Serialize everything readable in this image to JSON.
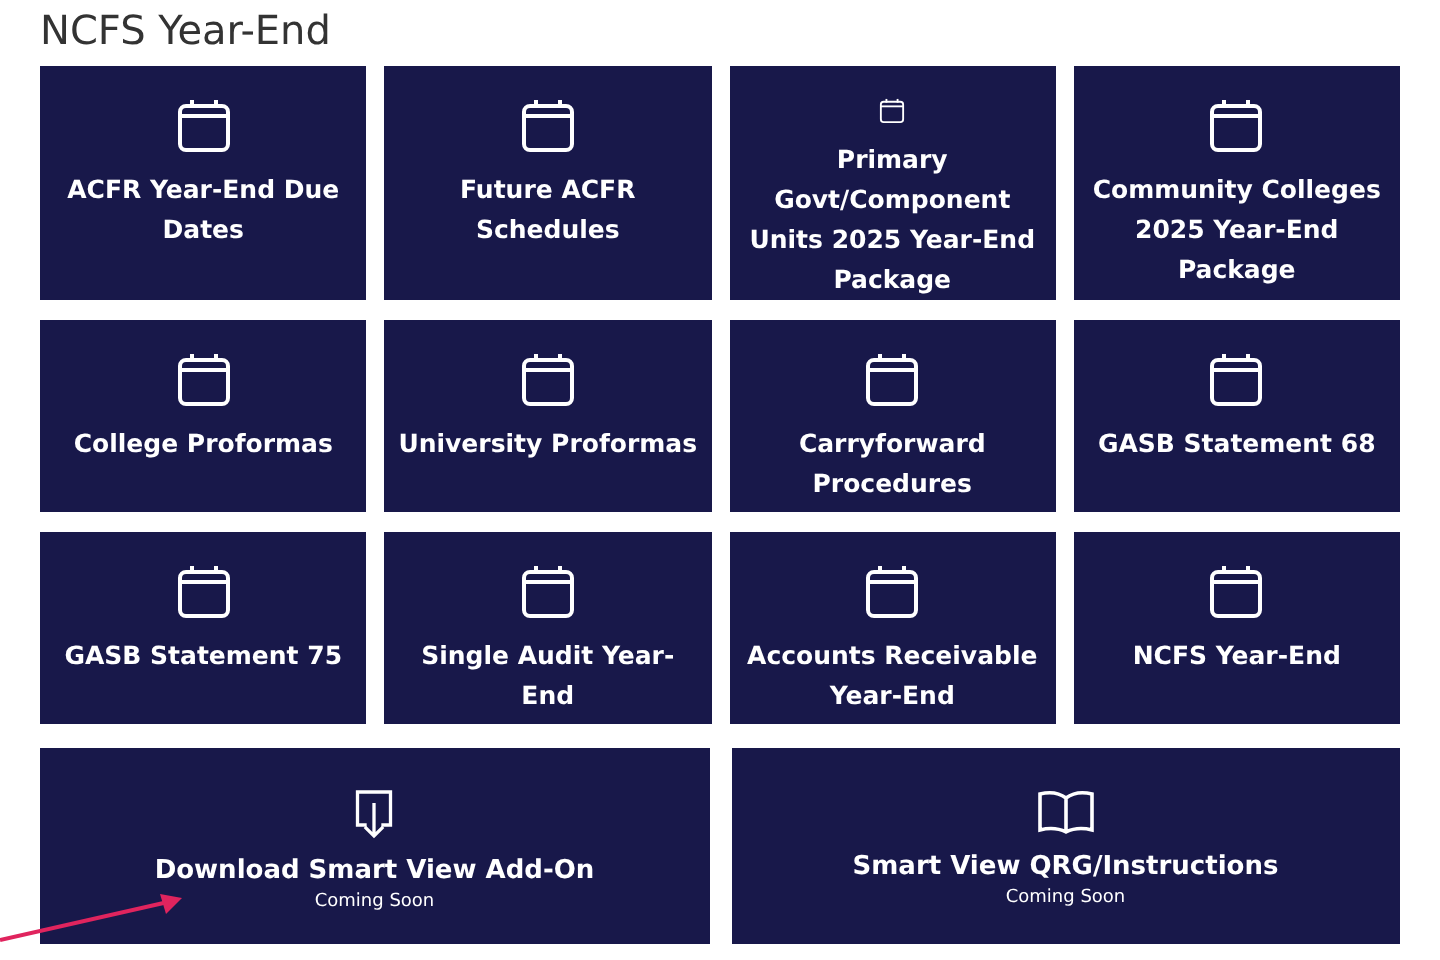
{
  "title": "NCFS Year-End",
  "tiles": [
    {
      "kind": "calendar",
      "label": "ACFR Year-End Due Dates"
    },
    {
      "kind": "calendar",
      "label": "Future ACFR Schedules"
    },
    {
      "kind": "calendar",
      "label": "Primary Govt/Component Units 2025 Year-End Package"
    },
    {
      "kind": "calendar",
      "label": "Community Colleges 2025 Year-End Package"
    },
    {
      "kind": "calendar",
      "label": "College Proformas"
    },
    {
      "kind": "calendar",
      "label": "University Proformas"
    },
    {
      "kind": "calendar",
      "label": "Carryforward Procedures"
    },
    {
      "kind": "calendar",
      "label": "GASB Statement 68"
    },
    {
      "kind": "calendar",
      "label": "GASB Statement 75"
    },
    {
      "kind": "calendar",
      "label": "Single Audit Year-End"
    },
    {
      "kind": "calendar",
      "label": "Accounts Receivable Year-End"
    },
    {
      "kind": "calendar",
      "label": "NCFS Year-End"
    }
  ],
  "wide_tiles": [
    {
      "kind": "download",
      "label": "Download Smart View Add-On",
      "note": "Coming Soon"
    },
    {
      "kind": "book",
      "label": "Smart View QRG/Instructions",
      "note": "Coming Soon"
    }
  ]
}
